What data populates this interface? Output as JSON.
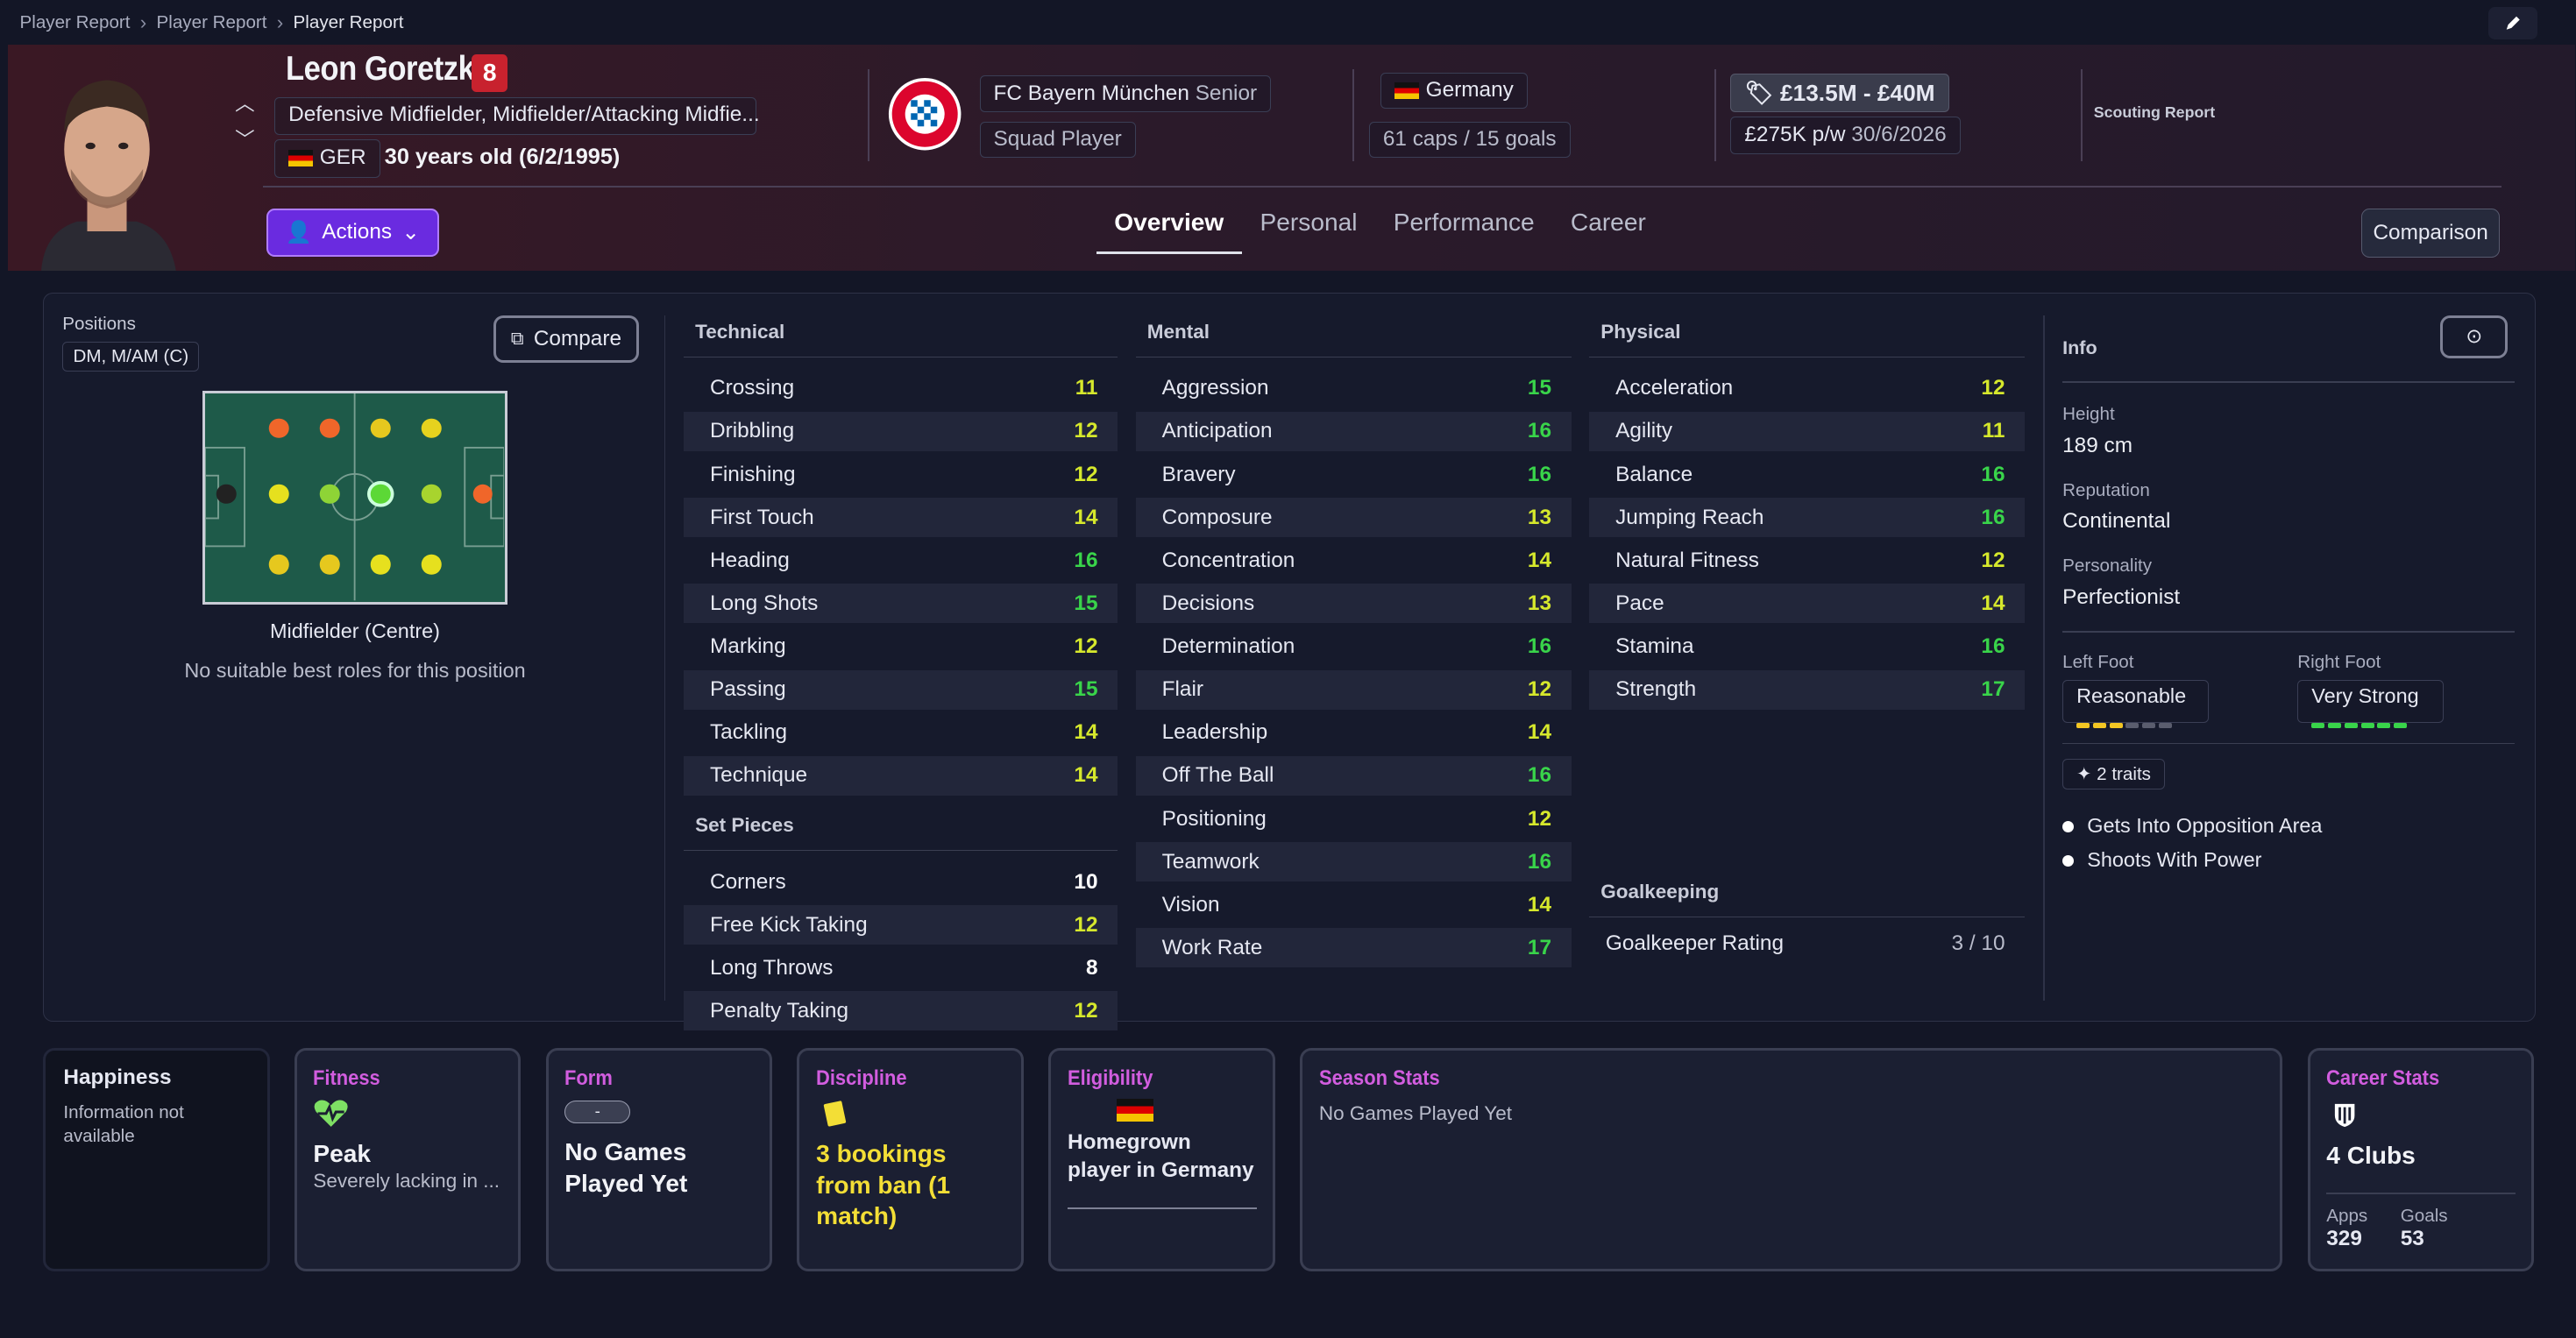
{
  "breadcrumbs": [
    "Player Report",
    "Player Report",
    "Player Report"
  ],
  "player": {
    "name": "Leon Goretzka",
    "number": "8",
    "positions_text": "Defensive Midfielder, Midfielder/Attacking Midfie...",
    "nation_code": "GER",
    "age_text": "30 years old (6/2/1995)"
  },
  "club": {
    "name": "FC Bayern München",
    "level": "Senior",
    "status": "Squad Player"
  },
  "nation": {
    "name": "Germany",
    "caps": "61 caps / 15 goals"
  },
  "value": {
    "range": "£13.5M - £40M",
    "wage": "£275K p/w",
    "contract_end": "30/6/2026"
  },
  "scouting_report": "Scouting Report",
  "actions_label": "Actions",
  "tabs": [
    "Overview",
    "Personal",
    "Performance",
    "Career"
  ],
  "comparison_label": "Comparison",
  "positions": {
    "label": "Positions",
    "value": "DM, M/AM (C)",
    "compare": "Compare",
    "role": "Midfielder (Centre)",
    "note": "No suitable best roles for this position"
  },
  "technical": {
    "title": "Technical",
    "rows": [
      [
        "Crossing",
        "11"
      ],
      [
        "Dribbling",
        "12"
      ],
      [
        "Finishing",
        "12"
      ],
      [
        "First Touch",
        "14"
      ],
      [
        "Heading",
        "16"
      ],
      [
        "Long Shots",
        "15"
      ],
      [
        "Marking",
        "12"
      ],
      [
        "Passing",
        "15"
      ],
      [
        "Tackling",
        "14"
      ],
      [
        "Technique",
        "14"
      ]
    ]
  },
  "set_pieces": {
    "title": "Set Pieces",
    "rows": [
      [
        "Corners",
        "10"
      ],
      [
        "Free Kick Taking",
        "12"
      ],
      [
        "Long Throws",
        "8"
      ],
      [
        "Penalty Taking",
        "12"
      ]
    ]
  },
  "mental": {
    "title": "Mental",
    "rows": [
      [
        "Aggression",
        "15"
      ],
      [
        "Anticipation",
        "16"
      ],
      [
        "Bravery",
        "16"
      ],
      [
        "Composure",
        "13"
      ],
      [
        "Concentration",
        "14"
      ],
      [
        "Decisions",
        "13"
      ],
      [
        "Determination",
        "16"
      ],
      [
        "Flair",
        "12"
      ],
      [
        "Leadership",
        "14"
      ],
      [
        "Off The Ball",
        "16"
      ],
      [
        "Positioning",
        "12"
      ],
      [
        "Teamwork",
        "16"
      ],
      [
        "Vision",
        "14"
      ],
      [
        "Work Rate",
        "17"
      ]
    ]
  },
  "physical": {
    "title": "Physical",
    "rows": [
      [
        "Acceleration",
        "12"
      ],
      [
        "Agility",
        "11"
      ],
      [
        "Balance",
        "16"
      ],
      [
        "Jumping Reach",
        "16"
      ],
      [
        "Natural Fitness",
        "12"
      ],
      [
        "Pace",
        "14"
      ],
      [
        "Stamina",
        "16"
      ],
      [
        "Strength",
        "17"
      ]
    ]
  },
  "goalkeeping": {
    "title": "Goalkeeping",
    "label": "Goalkeeper Rating",
    "value": "3 / 10"
  },
  "info": {
    "title": "Info",
    "height_label": "Height",
    "height": "189 cm",
    "reputation_label": "Reputation",
    "reputation": "Continental",
    "personality_label": "Personality",
    "personality": "Perfectionist",
    "left_foot_label": "Left Foot",
    "left_foot": "Reasonable",
    "left_foot_level": 3,
    "right_foot_label": "Right Foot",
    "right_foot": "Very Strong",
    "right_foot_level": 6,
    "traits_count": "2 traits",
    "traits": [
      "Gets Into Opposition Area",
      "Shoots With Power"
    ]
  },
  "cards": {
    "happiness": {
      "title": "Happiness",
      "text": "Information not available"
    },
    "fitness": {
      "title": "Fitness",
      "value": "Peak",
      "sub": "Severely lacking in ..."
    },
    "form": {
      "title": "Form",
      "badge": "-",
      "value": "No Games Played Yet"
    },
    "discipline": {
      "title": "Discipline",
      "value": "3 bookings from ban (1 match)"
    },
    "eligibility": {
      "title": "Eligibility",
      "value": "Homegrown player in Germany"
    },
    "season": {
      "title": "Season Stats",
      "value": "No Games Played Yet"
    },
    "career": {
      "title": "Career Stats",
      "value": "4 Clubs",
      "apps_label": "Apps",
      "apps": "329",
      "goals_label": "Goals",
      "goals": "53"
    }
  },
  "colors": {
    "green": "#39d44a",
    "yellow": "#d6e82c",
    "accent": "#6a2be0",
    "card_title": "#d25ddf"
  }
}
